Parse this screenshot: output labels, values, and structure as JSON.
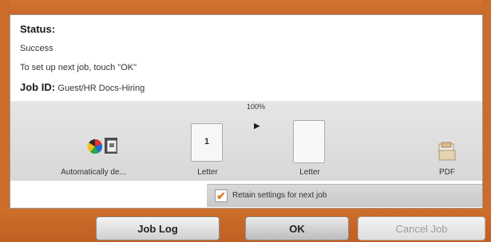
{
  "status": {
    "title": "Status:",
    "value": "Success",
    "instruction": "To set up next job, touch \"OK\"",
    "job_id_label": "Job ID:",
    "job_id_value": "Guest/HR Docs-Hiring"
  },
  "settings": {
    "color_mode_label": "Automatically de...",
    "original_paper_number": "1",
    "original_paper_label": "Letter",
    "zoom": "100%",
    "output_paper_label": "Letter",
    "file_format_label": "PDF"
  },
  "retain": {
    "checked": true,
    "check_glyph": "✔",
    "label": "Retain settings for next job"
  },
  "buttons": {
    "job_log": "Job Log",
    "ok": "OK",
    "cancel_job": "Cancel Job"
  },
  "colors": {
    "frame_orange": "#cc6c2b",
    "checkmark": "#e07a20",
    "disabled_text": "#9b9b9b"
  }
}
